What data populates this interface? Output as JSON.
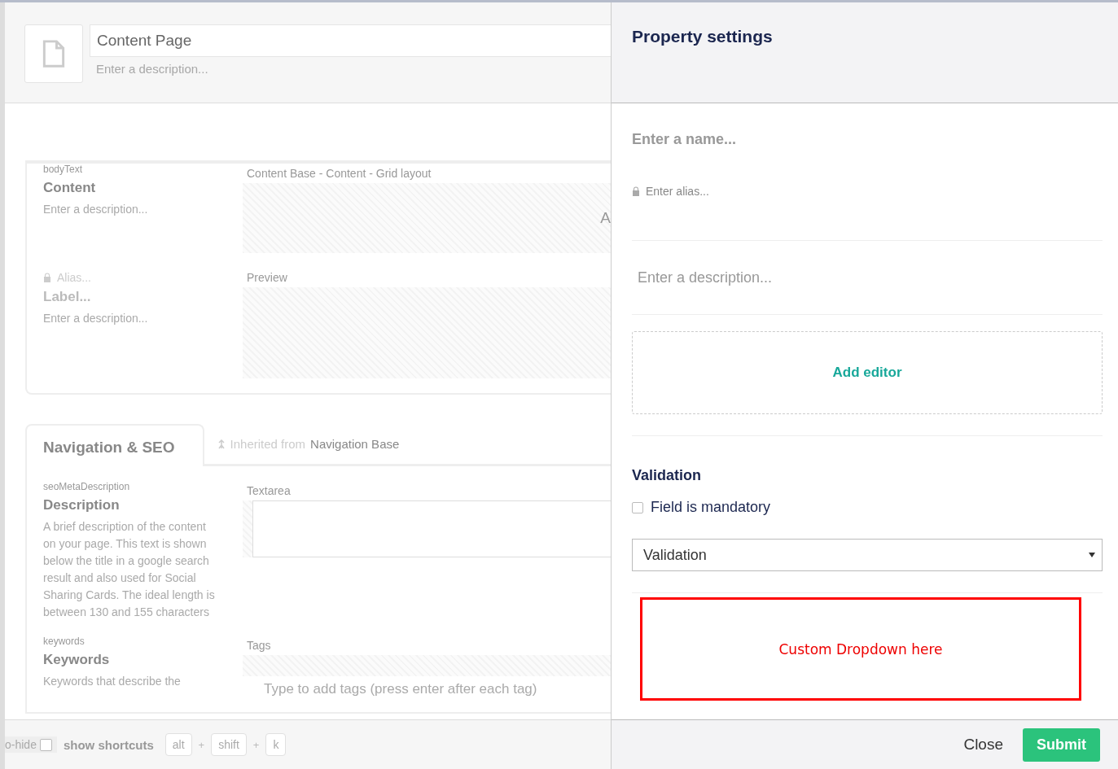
{
  "document": {
    "name": "Content Page",
    "description_placeholder": "Enter a description..."
  },
  "groups": [
    {
      "properties": [
        {
          "kind": "existing",
          "alias": "bodyText",
          "label": "Content",
          "description": "Enter a description...",
          "editor_label": "Content Base - Content - Grid layout",
          "preview_text": "A"
        },
        {
          "kind": "new",
          "alias": "Alias...",
          "label": "Label...",
          "description": "Enter a description...",
          "editor_label": "Preview"
        }
      ]
    },
    {
      "tab": {
        "label": "Navigation & SEO",
        "inherited_prefix": "Inherited from",
        "inherited_name": "Navigation Base"
      },
      "properties": [
        {
          "kind": "textarea",
          "alias": "seoMetaDescription",
          "label": "Description",
          "description": "A brief description of the content on your page. This text is shown below the title in a google search result and also used for Social Sharing Cards. The ideal length is between 130 and 155 characters",
          "editor_label": "Textarea"
        },
        {
          "kind": "tags",
          "alias": "keywords",
          "label": "Keywords",
          "description": "Keywords that describe the",
          "editor_label": "Tags",
          "placeholder": "Type to add tags (press enter after each tag)"
        }
      ]
    }
  ],
  "footer": {
    "auto_hide": {
      "label": "o-hide",
      "checked": false
    },
    "shortcuts_label": "show shortcuts",
    "key_separator": "+",
    "keys": [
      "alt",
      "shift",
      "k"
    ]
  },
  "panel": {
    "title": "Property settings",
    "name_placeholder": "Enter a name...",
    "alias_placeholder": "Enter alias...",
    "description_placeholder": "Enter a description...",
    "add_editor": "Add editor",
    "validation": {
      "heading": "Validation",
      "mandatory": {
        "label": "Field is mandatory",
        "checked": false
      },
      "select_value": "Validation"
    },
    "annotation": "Custom Dropdown here",
    "buttons": {
      "close": "Close",
      "submit": "Submit"
    }
  }
}
